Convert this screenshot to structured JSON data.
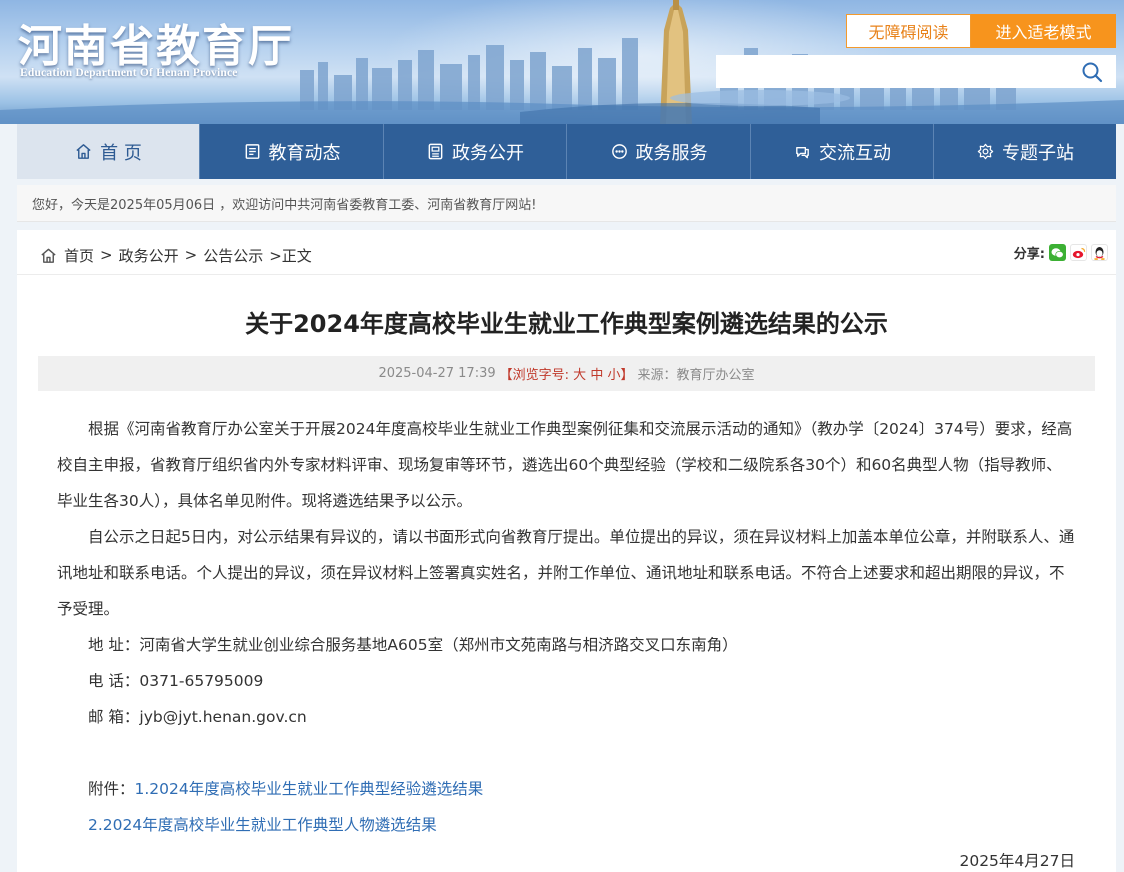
{
  "header": {
    "logo_cn": "河南省教育厅",
    "logo_en": "Education Department Of Henan Province",
    "accessibility_label": "无障碍阅读",
    "elder_mode_label": "进入适老模式",
    "search": {
      "value": "",
      "placeholder": ""
    }
  },
  "nav": {
    "items": [
      {
        "label": "首 页",
        "icon": "home-icon",
        "active": true
      },
      {
        "label": "教育动态",
        "icon": "news-icon"
      },
      {
        "label": "政务公开",
        "icon": "public-affairs-icon"
      },
      {
        "label": "政务服务",
        "icon": "service-icon"
      },
      {
        "label": "交流互动",
        "icon": "interaction-icon"
      },
      {
        "label": "专题子站",
        "icon": "subsite-icon"
      }
    ]
  },
  "welcome_text": "您好，今天是2025年05月06日 ，欢迎访问中共河南省委教育工委、河南省教育厅网站!",
  "breadcrumb": {
    "items": [
      "首页",
      "政务公开",
      "公告公示"
    ],
    "current": ">正文"
  },
  "share": {
    "label": "分享:",
    "icons": [
      "wechat-icon",
      "weibo-icon",
      "qq-icon"
    ]
  },
  "article": {
    "title": "关于2024年度高校毕业生就业工作典型案例遴选结果的公示",
    "date": "2025-04-27 17:39",
    "font_size_label": "【浏览字号:",
    "font_large": "大",
    "font_medium": "中",
    "font_small": "小",
    "font_size_close": "】",
    "source": "来源：教育厅办公室",
    "paragraph_1": "根据《河南省教育厅办公室关于开展2024年度高校毕业生就业工作典型案例征集和交流展示活动的通知》（教办学〔2024〕374号）要求，经高校自主申报，省教育厅组织省内外专家材料评审、现场复审等环节，遴选出60个典型经验（学校和二级院系各30个）和60名典型人物（指导教师、毕业生各30人），具体名单见附件。现将遴选结果予以公示。",
    "paragraph_2": "自公示之日起5日内，对公示结果有异议的，请以书面形式向省教育厅提出。单位提出的异议，须在异议材料上加盖本单位公章，并附联系人、通讯地址和联系电话。个人提出的异议，须在异议材料上签署真实姓名，并附工作单位、通讯地址和联系电话。不符合上述要求和超出期限的异议，不予受理。",
    "address": "地 址：河南省大学生就业创业综合服务基地A605室（郑州市文苑南路与相济路交叉口东南角）",
    "phone": "电 话：0371-65795009",
    "email": "邮 箱：jyb@jyt.henan.gov.cn",
    "attachment_label": "附件：",
    "attachment_1": "1.2024年度高校毕业生就业工作典型经验遴选结果",
    "attachment_2": "2.2024年度高校毕业生就业工作典型人物遴选结果",
    "sign_date": "2025年4月27日"
  },
  "colors": {
    "nav_bg": "#2f5f98",
    "nav_active_bg": "#dce4ee",
    "elder_button": "#f7941d",
    "link": "#2f6db4",
    "font_size_red": "#c0392b"
  }
}
